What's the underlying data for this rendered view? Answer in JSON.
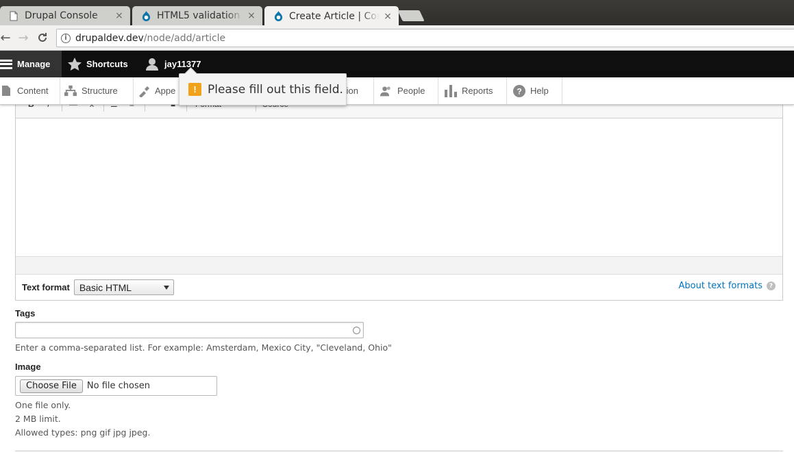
{
  "browser": {
    "tabs": [
      {
        "title": "Drupal Console",
        "icon": "page-icon",
        "close": "×"
      },
      {
        "title": "HTML5 validation w",
        "icon": "drupal-icon",
        "close": "×"
      },
      {
        "title": "Create Article | Con",
        "icon": "drupal-icon",
        "close": "×",
        "active": true
      }
    ],
    "url_host": "drupaldev.dev",
    "url_path": "/node/add/article"
  },
  "toolbar": {
    "manage": "Manage",
    "shortcuts": "Shortcuts",
    "user": "jay11377"
  },
  "tray": {
    "items": [
      "Content",
      "Structure",
      "Appe",
      "tion",
      "People",
      "Reports",
      "Help"
    ]
  },
  "validation": {
    "icon_glyph": "!",
    "message": "Please fill out this field."
  },
  "editor": {
    "toolbar": [
      "B",
      "I",
      "—",
      "x",
      "☰",
      "≡",
      "”",
      "■",
      "Format",
      "Source"
    ],
    "text_format_label": "Text format",
    "text_format_value": "Basic HTML",
    "about_link": "About text formats",
    "help_glyph": "?"
  },
  "tags": {
    "label": "Tags",
    "value": "",
    "description": "Enter a comma-separated list. For example: Amsterdam, Mexico City, \"Cleveland, Ohio\""
  },
  "image": {
    "label": "Image",
    "button": "Choose File",
    "status": "No file chosen",
    "help": [
      "One file only.",
      "2 MB limit.",
      "Allowed types: png gif jpg jpeg."
    ]
  },
  "colors": {
    "link": "#0074bd",
    "warning": "#f0a31a",
    "toolbar_bg": "#0f0f0f"
  }
}
